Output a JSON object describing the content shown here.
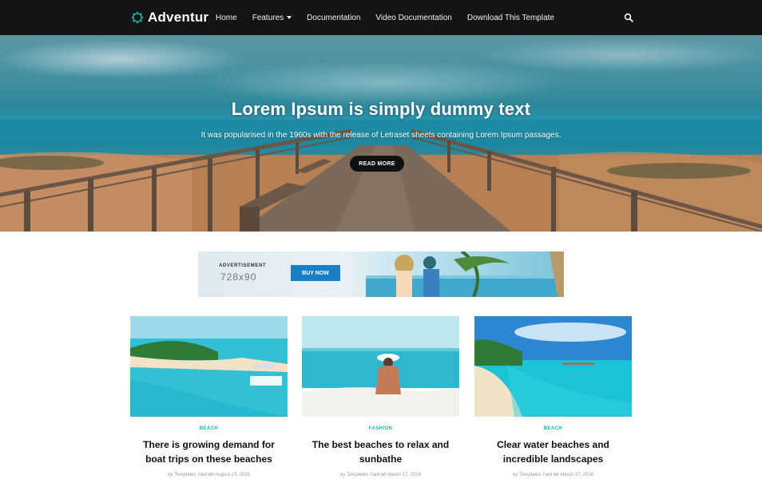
{
  "brand": {
    "name": "Adventur",
    "icon": "gear-icon"
  },
  "nav": {
    "items": [
      {
        "label": "Home"
      },
      {
        "label": "Features",
        "has_dropdown": true
      },
      {
        "label": "Documentation"
      },
      {
        "label": "Video Documentation"
      },
      {
        "label": "Download This Template"
      }
    ],
    "search_icon": "search-icon"
  },
  "hero": {
    "title": "Lorem Ipsum is simply dummy text",
    "subtitle": "It was popularised in the 1960s with the release of Letraset sheets containing Lorem Ipsum passages.",
    "button_label": "READ MORE"
  },
  "ad": {
    "label": "ADVERTISEMENT",
    "size": "728x90",
    "button_label": "BUY NOW"
  },
  "posts": [
    {
      "category": "BEACH",
      "title": "There is growing demand for boat trips on these beaches",
      "by": "by",
      "author": "Templates Yard",
      "on": "on",
      "date": "August 23, 2016"
    },
    {
      "category": "FASHION",
      "title": "The best beaches to relax and sunbathe",
      "by": "by",
      "author": "Templates Yard",
      "on": "on",
      "date": "March 17, 2016"
    },
    {
      "category": "BEACH",
      "title": "Clear water beaches and incredible landscapes",
      "by": "by",
      "author": "Templates Yard",
      "on": "on",
      "date": "March 17, 2016"
    }
  ],
  "colors": {
    "nav_bg": "#141414",
    "accent": "#13b7a3",
    "ad_button": "#1b7fc6",
    "hero_button": "#111111"
  }
}
